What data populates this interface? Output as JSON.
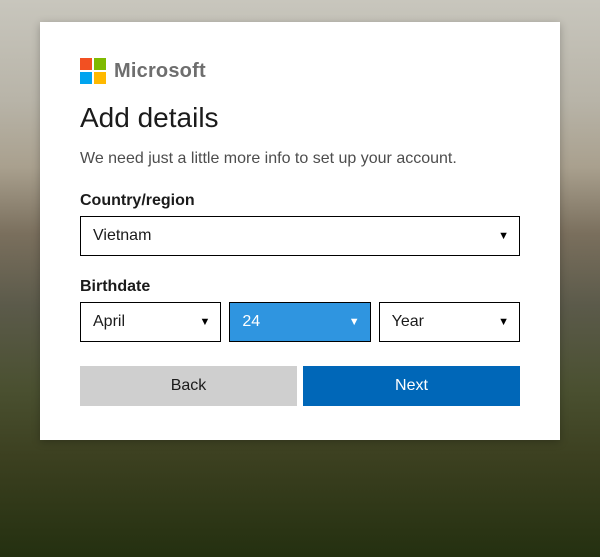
{
  "brand": {
    "name": "Microsoft"
  },
  "title": "Add details",
  "subtitle": "We need just a little more info to set up your account.",
  "country": {
    "label": "Country/region",
    "value": "Vietnam"
  },
  "birthdate": {
    "label": "Birthdate",
    "month": "April",
    "day": "24",
    "year": "Year"
  },
  "buttons": {
    "back": "Back",
    "next": "Next"
  }
}
